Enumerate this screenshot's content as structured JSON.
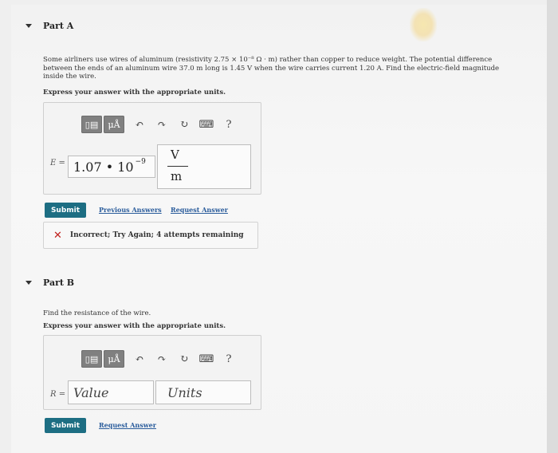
{
  "partA": {
    "title": "Part A",
    "question_l1": "Some airliners use wires of aluminum (resistivity 2.75 × 10⁻⁸ Ω · m) rather than copper to reduce weight. The potential difference",
    "question_l2": "between the ends of an aluminum wire 37.0 m long is 1.45 V when the wire carries current 1.20 A. Find the electric-field magnitude",
    "question_l3": "inside the wire.",
    "instruction": "Express your answer with the appropriate units.",
    "var_label": "E =",
    "value_mantissa": "1.07 • 10",
    "value_exponent": "−9",
    "unit_num": "V",
    "unit_den": "m",
    "submit_label": "Submit",
    "previous_answers": "Previous Answers",
    "request_answer": "Request Answer",
    "feedback_text": "Incorrect; Try Again; 4 attempts remaining"
  },
  "partB": {
    "title": "Part B",
    "question": "Find the resistance of the wire.",
    "instruction": "Express your answer with the appropriate units.",
    "var_label": "R =",
    "value_placeholder": "Value",
    "units_placeholder": "Units",
    "submit_label": "Submit",
    "request_answer": "Request Answer"
  },
  "toolbar": {
    "templates": "▯▤",
    "mu_label": "μÅ",
    "undo": "↶",
    "redo": "↷",
    "reset": "↻",
    "keyboard": "⌨",
    "help": "?"
  },
  "colors": {
    "submit": "#1d6e83",
    "link": "#2b5d9c",
    "error": "#c0201d",
    "toolbar_btn": "#808080"
  }
}
